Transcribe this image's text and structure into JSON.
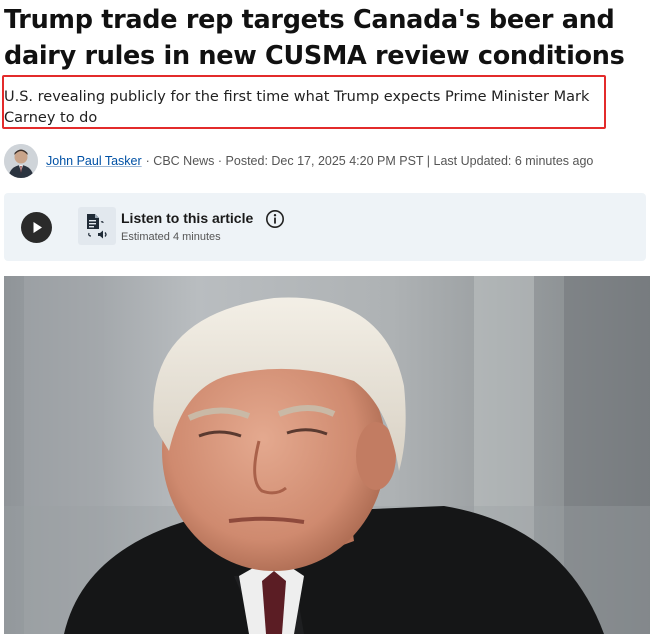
{
  "article": {
    "headline": "Trump trade rep targets Canada's beer and dairy rules in new CUSMA review conditions",
    "subheadline": "U.S. revealing publicly for the first time what Trump expects Prime Minister Mark Carney to do"
  },
  "byline": {
    "author": "John Paul Tasker",
    "meta": "· CBC News · Posted: Dec 17, 2025 4:20 PM PST | Last Updated: 6 minutes ago"
  },
  "audio": {
    "title": "Listen to this article",
    "duration": "Estimated 4 minutes"
  },
  "icons": {
    "play": "play-icon",
    "audio": "text-to-speech-icon",
    "info": "info-icon"
  },
  "colors": {
    "highlight_border": "#e32b2b",
    "author_link": "#0051a5",
    "audio_panel_bg": "#eef3f7"
  }
}
